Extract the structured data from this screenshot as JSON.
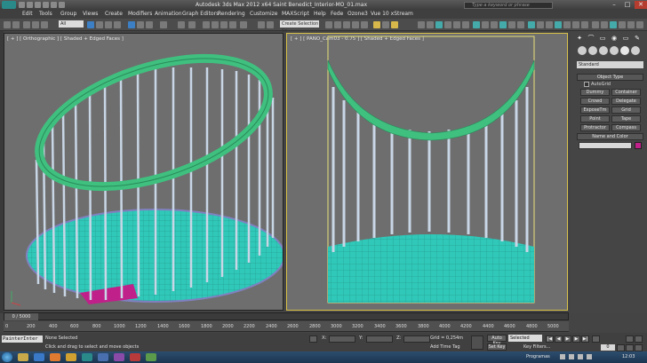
{
  "window": {
    "title": "Autodesk 3ds Max  2012 x64      Saint Benedict_Interior-MO_01.max",
    "search_placeholder": "Type a keyword or phrase",
    "minimize": "–",
    "maximize": "□",
    "close": "✕"
  },
  "menu": [
    "Edit",
    "Tools",
    "Group",
    "Views",
    "Create",
    "Modifiers",
    "Animation",
    "Graph Editors",
    "Rendering",
    "Customize",
    "MAXScript",
    "Help",
    "Fede",
    "Ozone3",
    "Vue 10 xStream"
  ],
  "toolbar": {
    "selection_filter": "All",
    "selection_set": "Create Selection Se"
  },
  "viewports": {
    "left_label": "[ + ] [ Orthographic ] [ Shaded + Edged Faces ]",
    "right_label": "[ + ] [ PANO_Cam03 - 0.75 ] [ Shaded + Edged Faces ]"
  },
  "command_panel": {
    "tabs": [
      "✦",
      "⌒",
      "▭",
      "◉",
      "▭",
      "✎"
    ],
    "category": "Standard",
    "object_type_header": "Object Type",
    "autogrid": "AutoGrid",
    "object_buttons": [
      "Dummy",
      "Container",
      "Crowd",
      "Delegate",
      "ExposeTm",
      "Grid",
      "Point",
      "Tape",
      "Protractor",
      "Compass"
    ],
    "name_color_header": "Name and Color"
  },
  "timeline": {
    "slider": "0 / 5000",
    "ticks": [
      "0",
      "200",
      "400",
      "600",
      "800",
      "1000",
      "1200",
      "1400",
      "1600",
      "1800",
      "2000",
      "2200",
      "2400",
      "2600",
      "2800",
      "3000",
      "3200",
      "3400",
      "3600",
      "3800",
      "4000",
      "4200",
      "4400",
      "4600",
      "4800",
      "5000"
    ]
  },
  "status": {
    "maxscript": "PainterInter",
    "selection": "None Selected",
    "prompt": "Click and drag to select and move objects",
    "x_label": "X:",
    "y_label": "Y:",
    "z_label": "Z:",
    "grid": "Grid = 0,254m",
    "add_time_tag": "Add Time Tag",
    "auto_key": "Auto Key",
    "set_key": "Set Key",
    "key_mode": "Selected",
    "key_filters": "Key Filters...",
    "frame": "0"
  },
  "taskbar": {
    "programs": "Programas",
    "clock": "12:03"
  },
  "colors": {
    "dome_green": "#3fc07f",
    "floor_teal": "#30c8b8",
    "magenta": "#c0208a",
    "viewport_bg": "#6e6e6e",
    "active_border": "#d8c24a"
  }
}
